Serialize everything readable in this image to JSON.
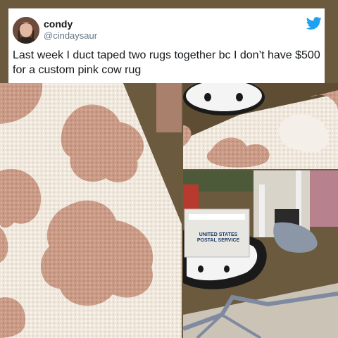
{
  "tweet": {
    "display_name": "condy",
    "handle": "@cindaysaur",
    "text": "Last week I duct taped two rugs together bc I don’t have $500 for a custom pink cow rug",
    "platform_icon": "twitter-bird-icon"
  },
  "photos": {
    "package_label": "UNITED STATES POSTAL SERVICE"
  },
  "colors": {
    "twitter_blue": "#1da1f2",
    "rug_cream": "#efe7dc",
    "rug_pink": "#c99a86",
    "floor_wood": "#6b5a3e"
  }
}
